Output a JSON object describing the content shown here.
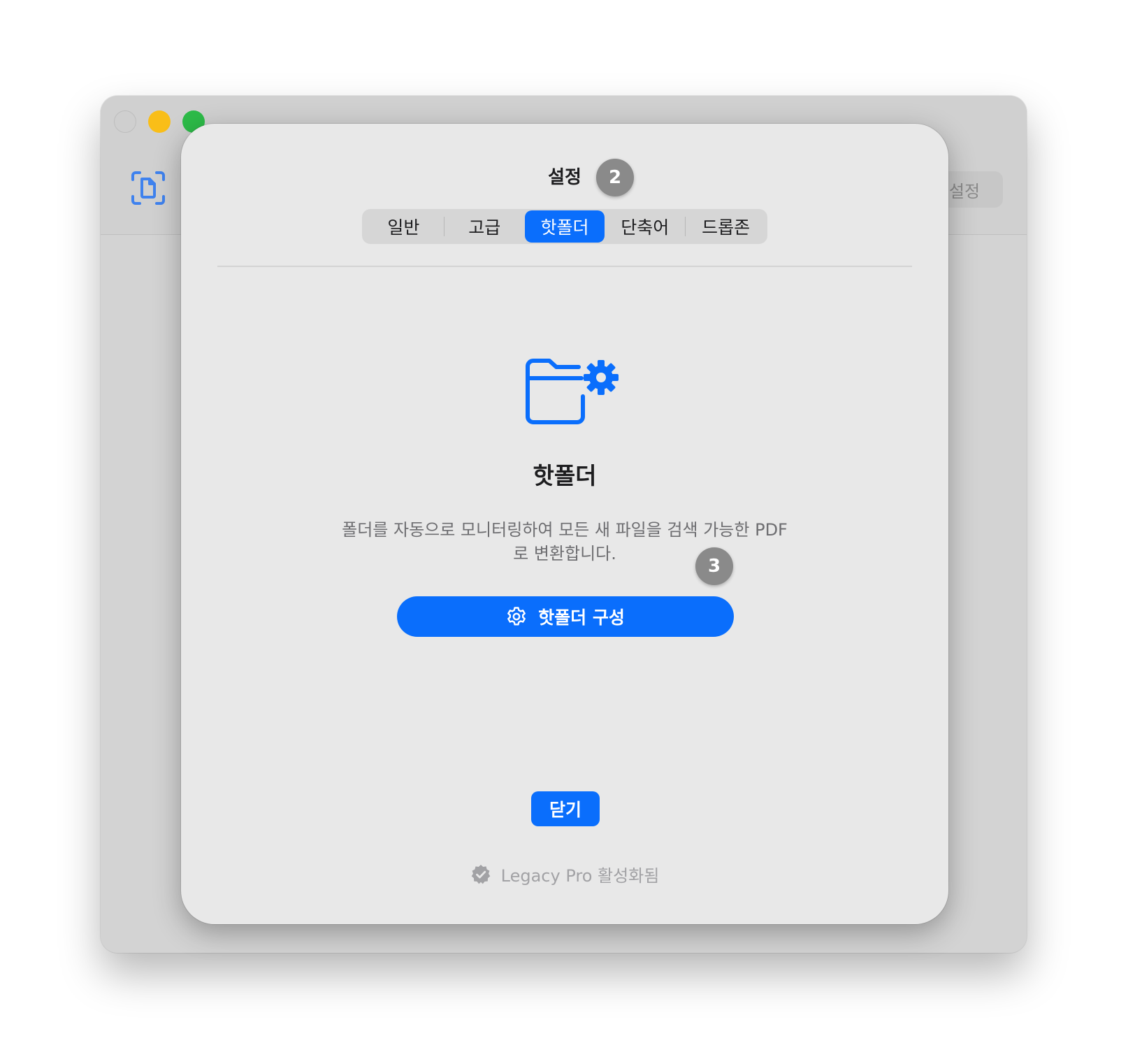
{
  "background_window": {
    "settings_button_label": "설정"
  },
  "sheet": {
    "title": "설정",
    "tabs": [
      {
        "label": "일반",
        "active": false
      },
      {
        "label": "고급",
        "active": false
      },
      {
        "label": "핫폴더",
        "active": true
      },
      {
        "label": "단축어",
        "active": false
      },
      {
        "label": "드롭존",
        "active": false
      }
    ],
    "section_heading": "핫폴더",
    "description_line1": "폴더를 자동으로 모니터링하여 모든 새 파일을 검색 가능한 PDF",
    "description_line2": "로 변환합니다.",
    "configure_button_label": "핫폴더 구성",
    "close_button_label": "닫기",
    "license_status": "Legacy Pro 활성화됨"
  },
  "annotations": {
    "badge_a": "2",
    "badge_b": "3"
  },
  "colors": {
    "accent": "#0a6efc",
    "traffic_minimize": "#f9be18",
    "traffic_maximize": "#2dbb48",
    "badge": "#8a8a8a"
  },
  "icons": {
    "app": "document-scan-icon",
    "section": "folder-gear-icon",
    "configure": "gear-icon",
    "license": "verified-badge-icon"
  }
}
